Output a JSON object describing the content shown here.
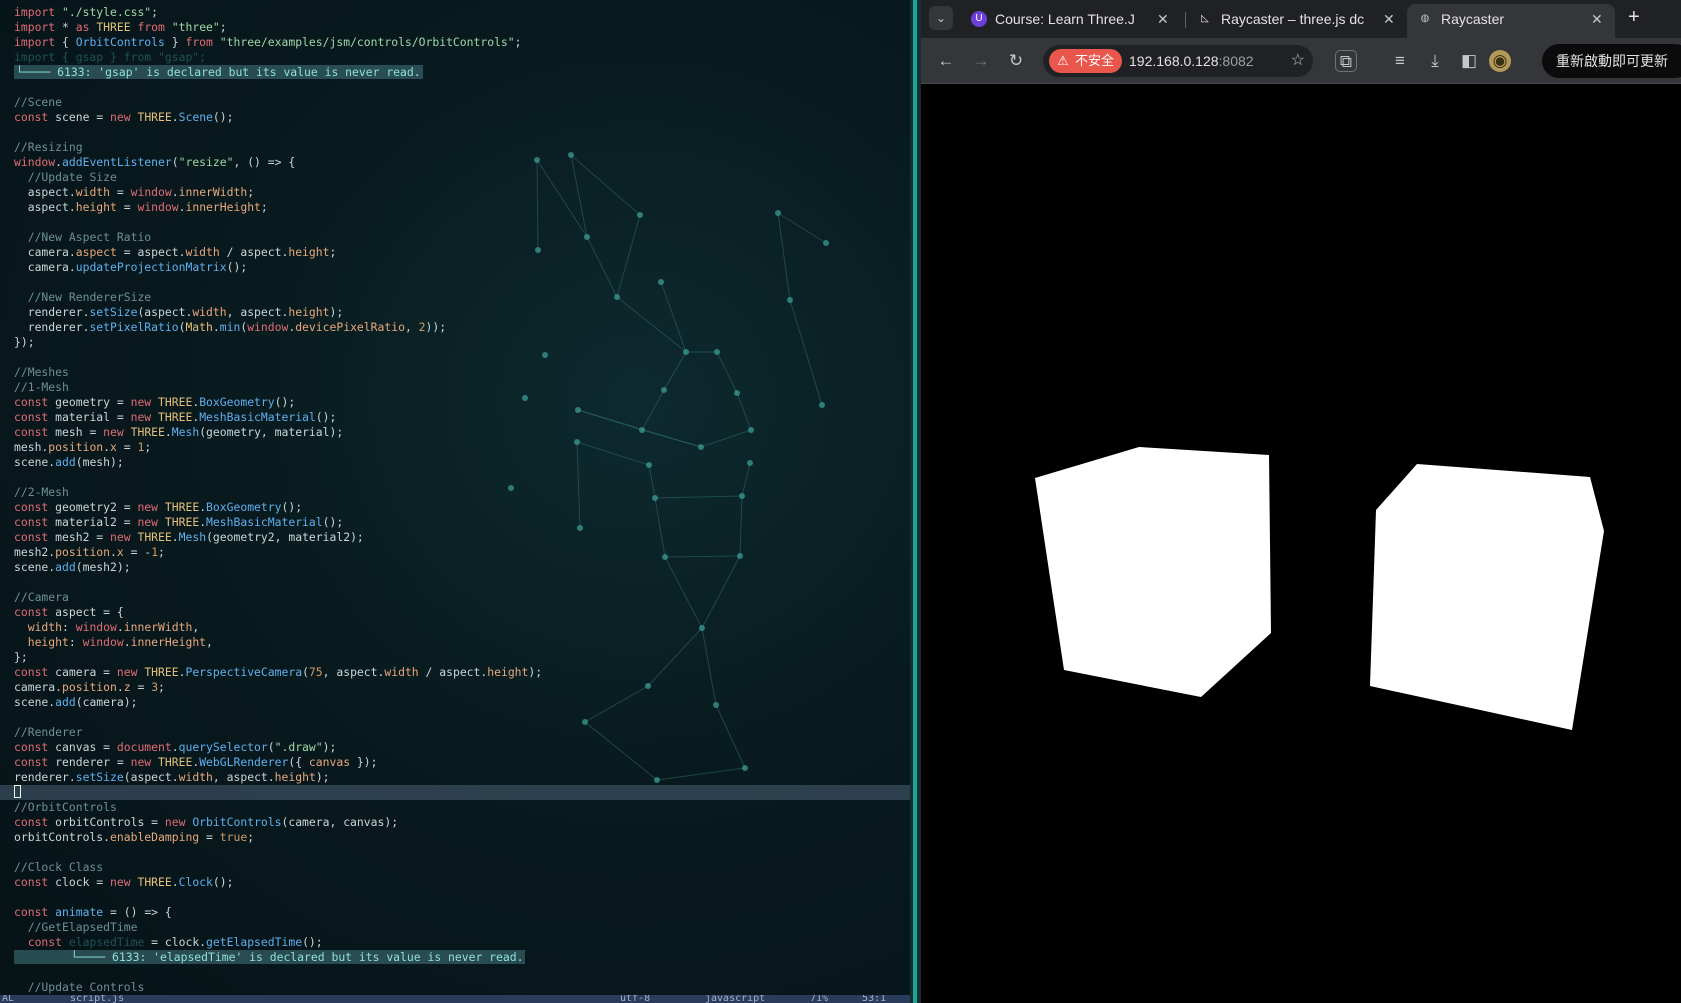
{
  "editor": {
    "code_lines": [
      "<span class='k'>import</span> <span class='s'>\"./style.css\"</span>;",
      "<span class='k'>import</span> * <span class='k'>as</span> <span class='t'>THREE</span> <span class='k'>from</span> <span class='s'>\"three\"</span>;",
      "<span class='k'>import</span> { <span class='f'>OrbitControls</span> } <span class='k'>from</span> <span class='s'>\"three/examples/jsm/controls/OrbitControls\"</span>;",
      "<span class='g'>import { gsap } from \"gsap\";</span>",
      "<span class='diag'><span class='box'>└──── 6133: 'gsap' is declared but its value is never read.</span></span>",
      "",
      "<span class='c'>//Scene</span>",
      "<span class='k'>const</span> scene = <span class='k'>new</span> <span class='t'>THREE</span>.<span class='f'>Scene</span>();",
      "",
      "<span class='c'>//Resizing</span>",
      "<span class='k'>window</span>.<span class='f'>addEventListener</span>(<span class='s'>\"resize\"</span>, () => {",
      "  <span class='c'>//Update Size</span>",
      "  aspect.<span class='p'>width</span> = <span class='k'>window</span>.<span class='p'>innerWidth</span>;",
      "  aspect.<span class='p'>height</span> = <span class='k'>window</span>.<span class='p'>innerHeight</span>;",
      "",
      "  <span class='c'>//New Aspect Ratio</span>",
      "  camera.<span class='p'>aspect</span> = aspect.<span class='p'>width</span> / aspect.<span class='p'>height</span>;",
      "  camera.<span class='f'>updateProjectionMatrix</span>();",
      "",
      "  <span class='c'>//New RendererSize</span>",
      "  renderer.<span class='f'>setSize</span>(aspect.<span class='p'>width</span>, aspect.<span class='p'>height</span>);",
      "  renderer.<span class='f'>setPixelRatio</span>(<span class='t'>Math</span>.<span class='f'>min</span>(<span class='k'>window</span>.<span class='p'>devicePixelRatio</span>, <span class='n'>2</span>));",
      "});",
      "",
      "<span class='c'>//Meshes</span>",
      "<span class='c'>//1-Mesh</span>",
      "<span class='k'>const</span> geometry = <span class='k'>new</span> <span class='t'>THREE</span>.<span class='f'>BoxGeometry</span>();",
      "<span class='k'>const</span> material = <span class='k'>new</span> <span class='t'>THREE</span>.<span class='f'>MeshBasicMaterial</span>();",
      "<span class='k'>const</span> mesh = <span class='k'>new</span> <span class='t'>THREE</span>.<span class='f'>Mesh</span>(geometry, material);",
      "mesh.<span class='p'>position</span>.<span class='p'>x</span> = <span class='n'>1</span>;",
      "scene.<span class='f'>add</span>(mesh);",
      "",
      "<span class='c'>//2-Mesh</span>",
      "<span class='k'>const</span> geometry2 = <span class='k'>new</span> <span class='t'>THREE</span>.<span class='f'>BoxGeometry</span>();",
      "<span class='k'>const</span> material2 = <span class='k'>new</span> <span class='t'>THREE</span>.<span class='f'>MeshBasicMaterial</span>();",
      "<span class='k'>const</span> mesh2 = <span class='k'>new</span> <span class='t'>THREE</span>.<span class='f'>Mesh</span>(geometry2, material2);",
      "mesh2.<span class='p'>position</span>.<span class='p'>x</span> = -<span class='n'>1</span>;",
      "scene.<span class='f'>add</span>(mesh2);",
      "",
      "<span class='c'>//Camera</span>",
      "<span class='k'>const</span> aspect = {",
      "  <span class='p'>width</span>: <span class='k'>window</span>.<span class='p'>innerWidth</span>,",
      "  <span class='p'>height</span>: <span class='k'>window</span>.<span class='p'>innerHeight</span>,",
      "};",
      "<span class='k'>const</span> camera = <span class='k'>new</span> <span class='t'>THREE</span>.<span class='f'>PerspectiveCamera</span>(<span class='n'>75</span>, aspect.<span class='p'>width</span> / aspect.<span class='p'>height</span>);",
      "camera.<span class='p'>position</span>.<span class='p'>z</span> = <span class='n'>3</span>;",
      "scene.<span class='f'>add</span>(camera);",
      "",
      "<span class='c'>//Renderer</span>",
      "<span class='k'>const</span> canvas = <span class='k'>document</span>.<span class='f'>querySelector</span>(<span class='s'>\".draw\"</span>);",
      "<span class='k'>const</span> renderer = <span class='k'>new</span> <span class='t'>THREE</span>.<span class='f'>WebGLRenderer</span>({ <span class='p'>canvas</span> });",
      "renderer.<span class='f'>setSize</span>(aspect.<span class='p'>width</span>, aspect.<span class='p'>height</span>);",
      "__CURSOR__",
      "<span class='c'>//OrbitControls</span>",
      "<span class='k'>const</span> orbitControls = <span class='k'>new</span> <span class='f'>OrbitControls</span>(camera, canvas);",
      "orbitControls.<span class='p'>enableDamping</span> = <span class='n'>true</span>;",
      "",
      "<span class='c'>//Clock Class</span>",
      "<span class='k'>const</span> clock = <span class='k'>new</span> <span class='t'>THREE</span>.<span class='f'>Clock</span>();",
      "",
      "<span class='k'>const</span> <span class='f'>animate</span> = () => {",
      "  <span class='c'>//GetElapsedTime</span>",
      "  <span class='k'>const</span> <span class='g'>elapsedTime</span> = clock.<span class='f'>getElapsedTime</span>();",
      "<span class='diag'><span class='box'>        └──── 6133: 'elapsedTime' is declared but its value is never read.</span></span>",
      "",
      "  <span class='c'>//Update Controls</span>"
    ],
    "status_mode": "AL",
    "status_file": "script.js",
    "status_encoding": "utf-8",
    "status_filetype": "javascript",
    "status_percent": "71%",
    "status_position": "53:1"
  },
  "browser": {
    "tabs": [
      {
        "title": "Course: Learn Three.J",
        "icon": "course-u-icon"
      },
      {
        "title": "Raycaster – three.js dc",
        "icon": "threejs-icon"
      },
      {
        "title": "Raycaster",
        "icon": "globe-icon"
      }
    ],
    "security_label": "不安全",
    "url_host": "192.168.0.128",
    "url_port": ":8082",
    "update_label": "重新啟動即可更新"
  },
  "colors": {
    "editor_bg": "#081a1e",
    "accent_divider": "#1ea39a",
    "insecure_chip": "#e8564c",
    "cube_color": "#ffffff"
  }
}
